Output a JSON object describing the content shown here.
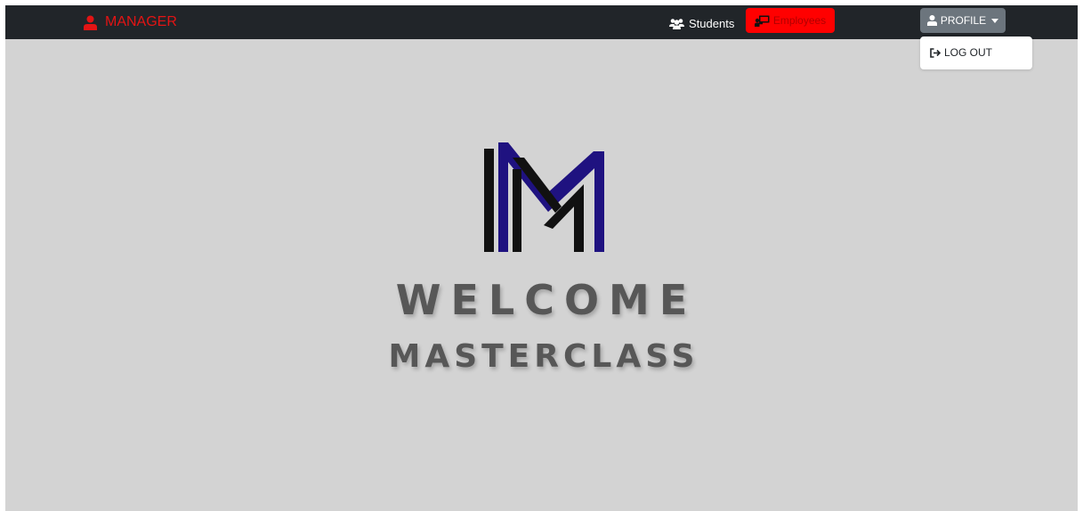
{
  "navbar": {
    "brand_label": "MANAGER",
    "students_label": "Students",
    "employees_label": "Employees",
    "profile_label": "PROFILE"
  },
  "dropdown": {
    "logout_label": "LOG OUT"
  },
  "hero": {
    "welcome": "WELCOME",
    "subtitle": "MASTERCLASS"
  },
  "icons": {
    "brand": "user-icon",
    "students": "users-icon",
    "employees": "chalkboard-teacher-icon",
    "profile": "user-icon",
    "caret": "caret-down-icon",
    "logout": "sign-out-icon"
  },
  "colors": {
    "navbar": "#212529",
    "brand": "#e31414",
    "employees_active": "#ff0000",
    "profile_button": "#6c757d",
    "background": "#d3d3d3",
    "logo_dark": "#111111",
    "logo_accent": "#1f1280",
    "hero_text": "#575757"
  }
}
